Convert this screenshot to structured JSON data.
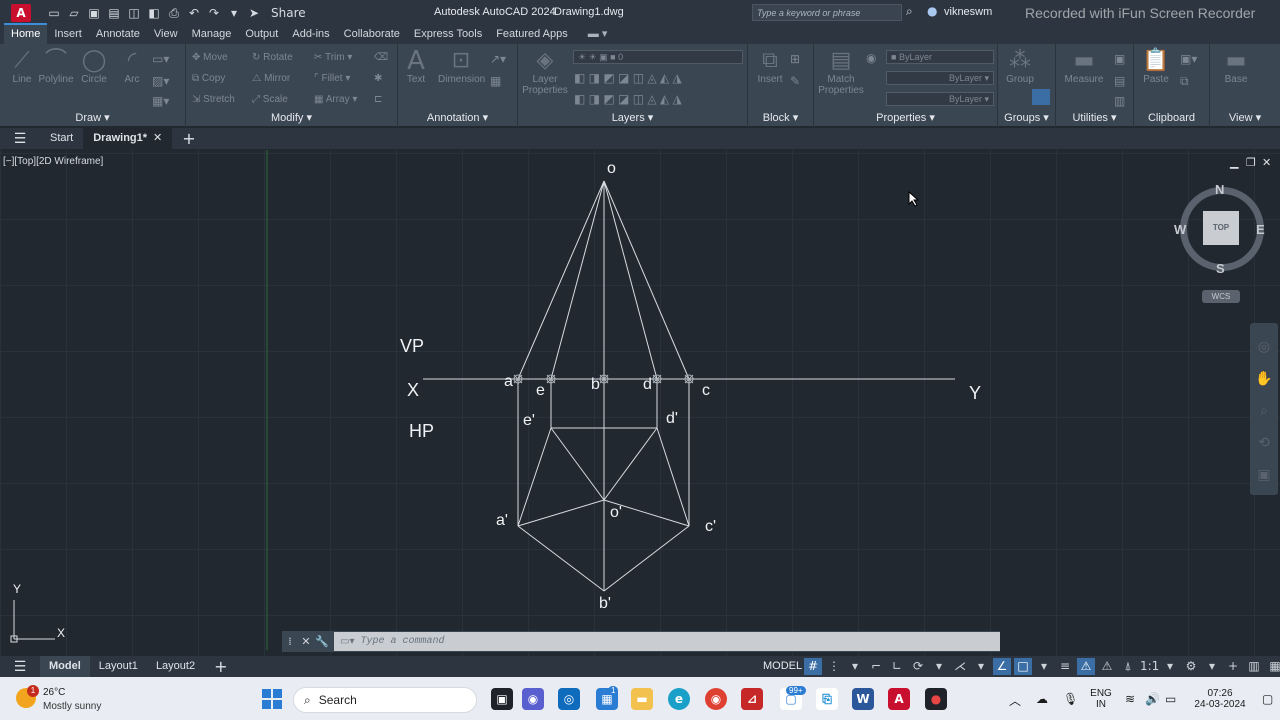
{
  "window": {
    "app_title": "Autodesk AutoCAD 2024",
    "doc_title": "Drawing1.dwg",
    "search_placeholder": "Type a keyword or phrase",
    "user": "vikneswm",
    "share_label": "Share",
    "watermark": "Recorded with iFun Screen Recorder"
  },
  "ribbon_tabs": [
    "Home",
    "Insert",
    "Annotate",
    "View",
    "Manage",
    "Output",
    "Add-ins",
    "Collaborate",
    "Express Tools",
    "Featured Apps"
  ],
  "ribbon_panels": {
    "draw": {
      "label": "Draw",
      "tools": [
        "Line",
        "Polyline",
        "Circle",
        "Arc"
      ]
    },
    "modify": {
      "label": "Modify",
      "tools": [
        "Move",
        "Rotate",
        "Trim",
        "Copy",
        "Mirror",
        "Fillet",
        "Stretch",
        "Scale",
        "Array"
      ]
    },
    "annotation": {
      "label": "Annotation",
      "tools": [
        "Text",
        "Dimension"
      ]
    },
    "layers": {
      "label": "Layers",
      "tools": [
        "Layer Properties"
      ],
      "layer_value": "0"
    },
    "block": {
      "label": "Block",
      "tools": [
        "Insert"
      ]
    },
    "properties": {
      "label": "Properties",
      "tools": [
        "Match Properties"
      ],
      "bylayer": "ByLayer"
    },
    "groups": {
      "label": "Groups",
      "tools": [
        "Group"
      ]
    },
    "utilities": {
      "label": "Utilities",
      "tools": [
        "Measure"
      ]
    },
    "clipboard": {
      "label": "Clipboard",
      "tools": [
        "Paste"
      ]
    },
    "view": {
      "label": "View",
      "tools": [
        "Base"
      ]
    }
  },
  "file_tabs": {
    "start": "Start",
    "active": "Drawing1*"
  },
  "viewport": {
    "controls": "[−][Top][2D Wireframe]"
  },
  "viewcube": {
    "top": "TOP",
    "n": "N",
    "s": "S",
    "e": "E",
    "w": "W",
    "wcs": "WCS"
  },
  "ucs": {
    "x": "X",
    "y": "Y"
  },
  "drawing_labels": {
    "o": "o",
    "vp": "VP",
    "hp": "HP",
    "x": "X",
    "y": "Y",
    "a": "a",
    "e": "e",
    "b": "b",
    "d": "d",
    "c": "c",
    "e_prime": "e'",
    "d_prime": "d'",
    "a_prime": "a'",
    "o_prime": "o'",
    "c_prime": "c'",
    "b_prime": "b'"
  },
  "command_line": {
    "placeholder": "Type a command"
  },
  "layout_tabs": [
    "Model",
    "Layout1",
    "Layout2"
  ],
  "status": {
    "model": "MODEL",
    "scale": "1:1"
  },
  "taskbar": {
    "temperature": "26°C",
    "condition": "Mostly sunny",
    "weather_badge": "1",
    "search": "Search",
    "store_badge": "1",
    "notif_badge": "99+",
    "lang1": "ENG",
    "lang2": "IN",
    "time": "07:26",
    "date": "24-03-2024"
  }
}
